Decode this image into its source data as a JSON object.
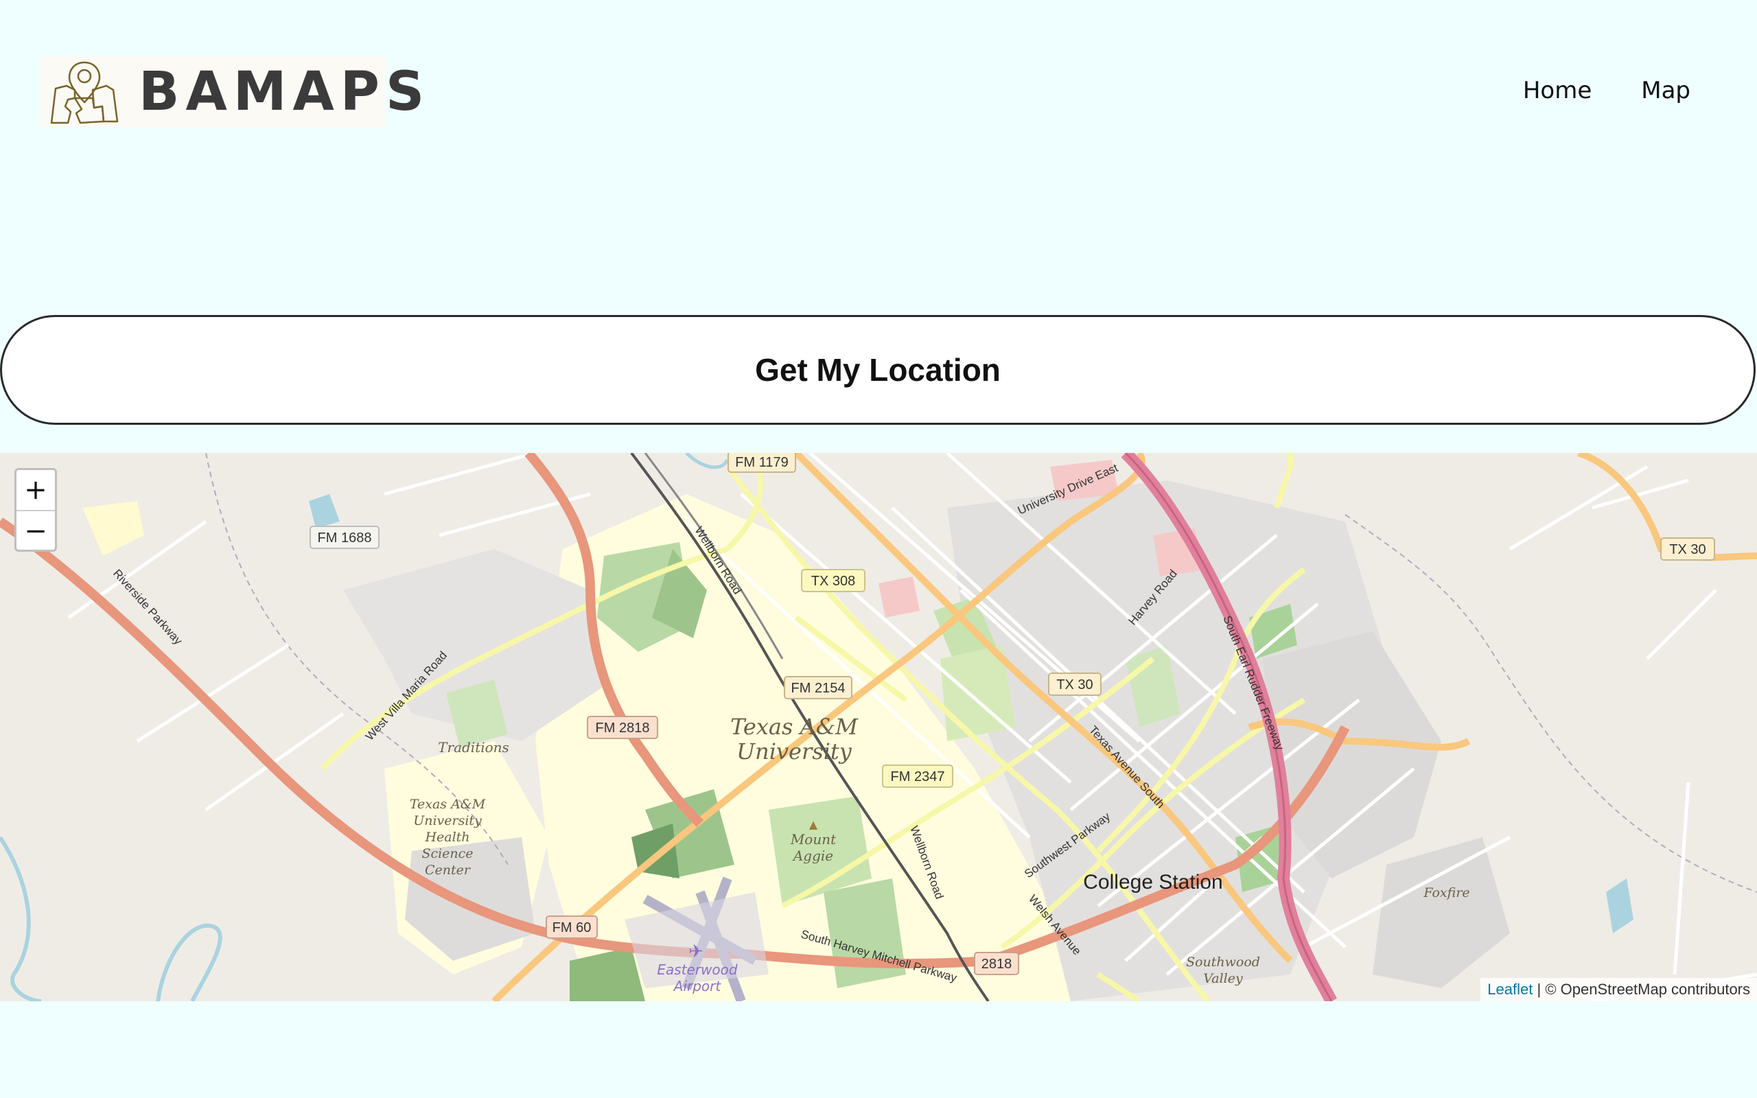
{
  "header": {
    "logo_text": "BAMAPS",
    "nav": [
      {
        "label": "Home"
      },
      {
        "label": "Map"
      }
    ]
  },
  "locate_button": {
    "label": "Get My Location"
  },
  "map": {
    "zoom_in": "+",
    "zoom_out": "−",
    "attribution": {
      "leaflet": "Leaflet",
      "separator": " | ",
      "osm": "© OpenStreetMap contributors"
    },
    "labels": {
      "university": [
        "Texas A&M",
        "University"
      ],
      "city": "College Station",
      "traditions": "Traditions",
      "hsc": [
        "Texas A&M",
        "University",
        "Health",
        "Science",
        "Center"
      ],
      "mount_aggie": [
        "Mount",
        "Aggie"
      ],
      "airport": [
        "Easterwood",
        "Airport"
      ],
      "southwood": [
        "Southwood",
        "Valley"
      ],
      "foxfire": "Foxfire"
    },
    "shields": [
      "FM 1179",
      "FM 1688",
      "TX 308",
      "TX 30",
      "FM 2154",
      "TX 30",
      "FM 2818",
      "FM 2347",
      "FM 60",
      "2818"
    ],
    "roads": [
      "University Drive East",
      "Wellborn Road",
      "Harvey Road",
      "South Earl Rudder Freeway",
      "Riverside Parkway",
      "West Villa Maria Road",
      "Texas Avenue South",
      "Southwest Parkway",
      "Welsh Avenue",
      "Wellborn Road",
      "South Harvey Mitchell Parkway"
    ]
  }
}
